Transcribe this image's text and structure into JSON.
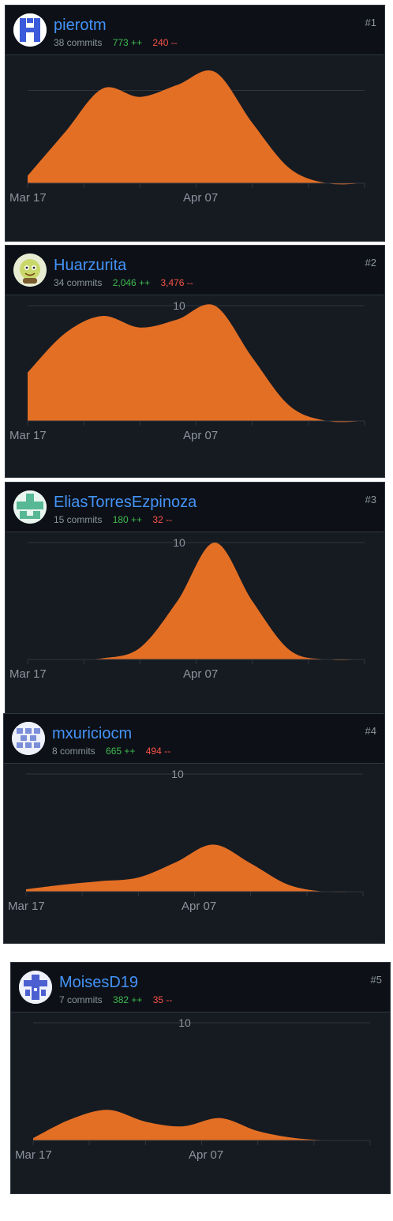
{
  "contributors": [
    {
      "rank": "#1",
      "username": "pierotm",
      "commits": "38 commits",
      "additions": "773 ++",
      "deletions": "240 --",
      "avatar_icon": "blue-identicon",
      "avatar_color": "#3b5bdb",
      "chart_data": {
        "type": "area",
        "x_tick_labels": [
          "Mar 17",
          "Apr 07"
        ],
        "y_tick_labels": [],
        "ylim": [
          0,
          12
        ],
        "grid": true,
        "series": [
          {
            "color": "#e36f25",
            "values": [
              0.8,
              5.5,
              10.2,
              9.3,
              10.6,
              12.0,
              6.5,
              1.6,
              0.0,
              0.0
            ]
          }
        ]
      }
    },
    {
      "rank": "#2",
      "username": "Huarzurita",
      "commits": "34 commits",
      "additions": "2,046 ++",
      "deletions": "3,476 --",
      "avatar_icon": "cartoon-avatar",
      "avatar_color": "#c9d86b",
      "chart_data": {
        "type": "area",
        "x_tick_labels": [
          "Mar 17",
          "Apr 07"
        ],
        "y_tick_labels": [
          "10"
        ],
        "ylim": [
          0,
          10
        ],
        "grid": true,
        "series": [
          {
            "color": "#e36f25",
            "values": [
              4.2,
              7.6,
              9.1,
              8.1,
              8.8,
              10.0,
              5.5,
              1.3,
              0.0,
              0.0
            ]
          }
        ]
      }
    },
    {
      "rank": "#3",
      "username": "EliasTorresEzpinoza",
      "commits": "15 commits",
      "additions": "180 ++",
      "deletions": "32 --",
      "avatar_icon": "green-identicon",
      "avatar_color": "#57b895",
      "chart_data": {
        "type": "area",
        "x_tick_labels": [
          "Mar 17",
          "Apr 07"
        ],
        "y_tick_labels": [
          "10"
        ],
        "ylim": [
          0,
          10
        ],
        "grid": true,
        "series": [
          {
            "color": "#e36f25",
            "values": [
              0.0,
              0.0,
              0.1,
              1.0,
              5.0,
              10.0,
              5.0,
              0.8,
              0.0,
              0.0
            ]
          }
        ]
      }
    },
    {
      "rank": "#4",
      "username": "mxuriciocm",
      "commits": "8 commits",
      "additions": "665 ++",
      "deletions": "494 --",
      "avatar_icon": "blue-identicon",
      "avatar_color": "#7b8ed8",
      "chart_data": {
        "type": "area",
        "x_tick_labels": [
          "Mar 17",
          "Apr 07"
        ],
        "y_tick_labels": [
          "10"
        ],
        "ylim": [
          0,
          10
        ],
        "grid": true,
        "series": [
          {
            "color": "#e36f25",
            "values": [
              0.2,
              0.6,
              0.9,
              1.2,
              2.5,
              4.0,
              2.4,
              0.6,
              0.0,
              0.0
            ]
          }
        ]
      }
    },
    {
      "rank": "#5",
      "username": "MoisesD19",
      "commits": "7 commits",
      "additions": "382 ++",
      "deletions": "35 --",
      "avatar_icon": "blue-identicon",
      "avatar_color": "#4b5fd1",
      "chart_data": {
        "type": "area",
        "x_tick_labels": [
          "Mar 17",
          "Apr 07"
        ],
        "y_tick_labels": [
          "10"
        ],
        "ylim": [
          0,
          10
        ],
        "grid": true,
        "series": [
          {
            "color": "#e36f25",
            "values": [
              0.2,
              1.8,
              2.6,
              1.6,
              1.2,
              1.9,
              0.8,
              0.2,
              0.0,
              0.0
            ]
          }
        ]
      }
    }
  ]
}
